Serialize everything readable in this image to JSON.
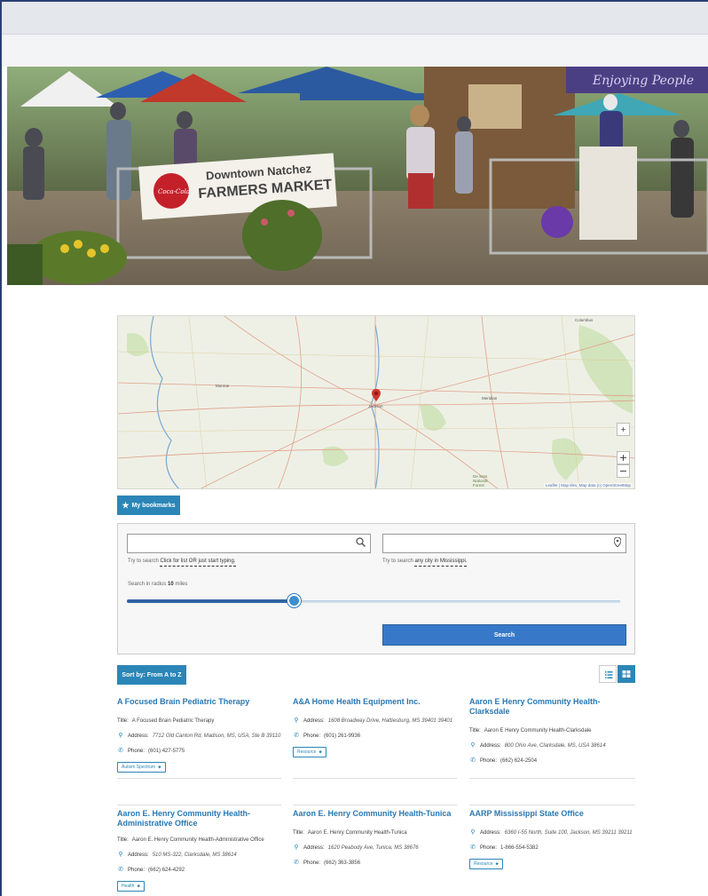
{
  "hero": {
    "banner_line1": "Downtown Natchez",
    "banner_line2": "FARMERS MARKET",
    "sign_right": "Enjoying People",
    "coke_logo": "Coca-Cola"
  },
  "map": {
    "city_center": "Jackson",
    "city_left": "Monroe",
    "city_right": "Meridian",
    "city_top_right": "Columbus",
    "forest_label": "De Soto National Forest",
    "attribution": "Leaflet | Map tiles, Map data (c) OpenStreetMap",
    "fullscreen_label": "+",
    "zoom_in": "+",
    "zoom_out": "−"
  },
  "bookmarks": {
    "label": "My bookmarks"
  },
  "search": {
    "keyword_placeholder": "",
    "keyword_hint_prefix": "Try to search",
    "keyword_hint_link": "Click for list OR just start typing.",
    "location_placeholder": "",
    "location_hint_prefix": "Try to search",
    "location_hint_link": "any city in Mississippi.",
    "radius_label_prefix": "Search in radius",
    "radius_value": "10",
    "radius_unit": "miles",
    "radius_fraction": 0.34,
    "button_label": "Search"
  },
  "sort": {
    "label": "Sort by: From A to Z"
  },
  "listings": [
    {
      "title": "A Focused Brain Pediatric Therapy",
      "title_label": "Title:",
      "title_value": "A Focused Brain Pediatric Therapy",
      "address_label": "Address:",
      "address": "7712 Old Canton Rd, Madison, MS, USA, Ste B 39110",
      "phone_label": "Phone:",
      "phone": "(601) 427-5775",
      "tag": "Autism Spectrum"
    },
    {
      "title": "A&A Home Health Equipment Inc.",
      "address_label": "Address:",
      "address": "1608 Broadway Drive, Hattiesburg, MS 39401 39401",
      "phone_label": "Phone:",
      "phone": "(601) 261-9936",
      "tag": "Resource"
    },
    {
      "title": "Aaron E Henry Community Health-Clarksdale",
      "title_label": "Title:",
      "title_value": "Aaron E Henry Community Health-Clarksdale",
      "address_label": "Address:",
      "address": "800 Ohio Ave, Clarksdale, MS, USA 38614",
      "phone_label": "Phone:",
      "phone": "(662) 624-2504"
    },
    {
      "title": "Aaron E. Henry Community Health-Administrative Office",
      "title_label": "Title:",
      "title_value": "Aaron E. Henry Community Health-Administrative Office",
      "address_label": "Address:",
      "address": "510 MS-322, Clarksdale, MS 38614",
      "phone_label": "Phone:",
      "phone": "(662) 624-4292",
      "tag": "Health"
    },
    {
      "title": "Aaron E. Henry Community Health-Tunica",
      "title_label": "Title:",
      "title_value": "Aaron E. Henry Community Health-Tunica",
      "address_label": "Address:",
      "address": "1620 Peabody Ave, Tunica, MS 38676",
      "phone_label": "Phone:",
      "phone": "(662) 363-3856"
    },
    {
      "title": "AARP Mississippi State Office",
      "address_label": "Address:",
      "address": "6360 I-55 North, Suite 100, Jackson, MS 39211 39211",
      "phone_label": "Phone:",
      "phone": "1-866-554-5382",
      "tag": "Resource"
    }
  ],
  "icons": {
    "star": "star-icon",
    "search": "search-icon",
    "location": "map-marker-icon",
    "phone": "phone-icon",
    "tag": "tag-icon",
    "list": "list-view-icon",
    "grid": "grid-view-icon"
  },
  "colors": {
    "accent": "#2b86b7",
    "link": "#2878b4",
    "search_button": "#3779c8",
    "slider": "#2f64a3"
  }
}
